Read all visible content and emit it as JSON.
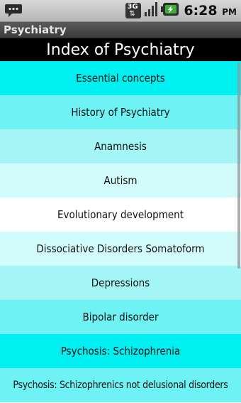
{
  "status_bar": {
    "network_type": "3G",
    "time": "6:28",
    "ampm": "PM",
    "icons": [
      "chat-notification-icon",
      "signal-icon",
      "battery-charging-icon"
    ]
  },
  "app": {
    "title": "Psychiatry"
  },
  "header": {
    "title": "Index of Psychiatry"
  },
  "colors": {
    "row_backgrounds": [
      "#00f0f2",
      "#6ff2f4",
      "#a4f5f6",
      "#d2fbfb",
      "#ffffff",
      "#d2fbfb",
      "#a4f5f6",
      "#6ff2f4",
      "#00f0f2",
      "#6ff2f4"
    ]
  },
  "items": [
    {
      "label": "Essential concepts"
    },
    {
      "label": "History of Psychiatry"
    },
    {
      "label": "Anamnesis"
    },
    {
      "label": "Autism"
    },
    {
      "label": "Evolutionary development"
    },
    {
      "label": "Dissociative Disorders Somatoform"
    },
    {
      "label": "Depressions"
    },
    {
      "label": "Bipolar disorder"
    },
    {
      "label": "Psychosis: Schizophrenia"
    },
    {
      "label": "Psychosis: Schizophrenics not delusional disorders"
    }
  ]
}
